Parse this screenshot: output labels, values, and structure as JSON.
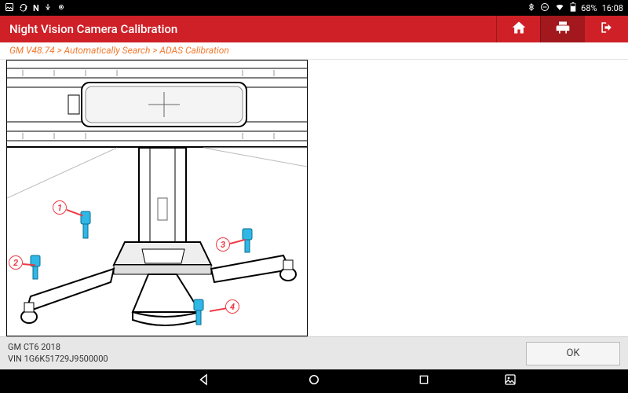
{
  "statusbar": {
    "battery_pct": "68%",
    "time": "16:08"
  },
  "header": {
    "title": "Night Vision Camera Calibration",
    "home_icon": "home",
    "print_icon": "print",
    "exit_icon": "exit"
  },
  "breadcrumb": {
    "text": "GM V48.74 > Automatically Search > ADAS Calibration"
  },
  "diagram": {
    "callouts": {
      "c1": "1",
      "c2": "2",
      "c3": "3",
      "c4": "4"
    }
  },
  "footer": {
    "vehicle": "GM CT6 2018",
    "vin": "VIN 1G6K51729J9500000",
    "ok_label": "OK"
  }
}
